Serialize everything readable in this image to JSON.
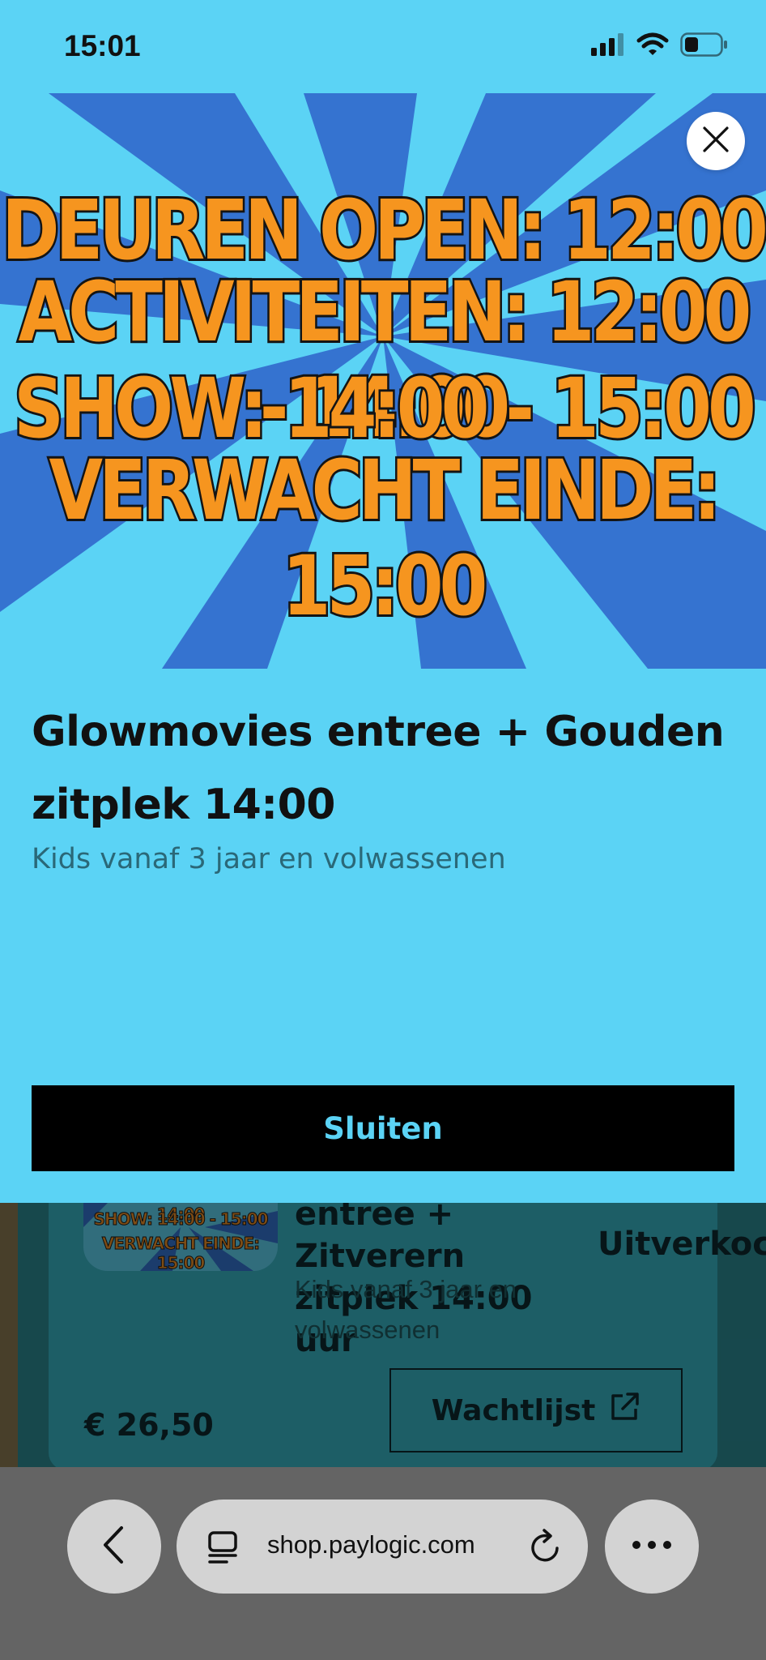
{
  "status_bar": {
    "time": "15:01",
    "icons": [
      "cellular-signal-icon",
      "wifi-icon",
      "battery-icon"
    ]
  },
  "hero": {
    "lines": [
      "DEUREN OPEN: 12:00",
      "ACTIVITEITEN: 12:00 - 14:00",
      "SHOW: 14:00 - 15:00",
      "VERWACHT EINDE: 15:00"
    ],
    "colors": {
      "background": "#5bd3f5",
      "rays": "#3573d0",
      "text": "#f6951f",
      "outline": "#141414"
    }
  },
  "modal": {
    "close_icon": "close-icon",
    "title": "Glowmovies entree + Gouden zitplek 14:00",
    "subtitle": "Kids vanaf 3 jaar en volwassenen",
    "primary_button": "Sluiten"
  },
  "background_listing": {
    "thumb_lines": [
      "ACTIVITEITEN: 12:00 - 14:00",
      "SHOW: 14:00 - 15:00",
      "VERWACHT EINDE: 15:00"
    ],
    "title": "entree + Zitverern zitplek 14:00 uur",
    "subtitle": "Kids vanaf 3 jaar en volwassenen",
    "status": "Uitverkoc",
    "price": "€ 26,50",
    "waitlist_button": "Wachtlijst",
    "waitlist_icon": "external-link-icon"
  },
  "browser": {
    "back_icon": "chevron-left-icon",
    "tabs_icon": "tab-overview-icon",
    "url": "shop.paylogic.com",
    "reload_icon": "reload-icon",
    "more_icon": "more-dots-icon"
  },
  "colors": {
    "modal_bg": "#5bd3f5",
    "button_bg": "#000000",
    "button_text": "#5bd3f5",
    "browser_bar": "#646464"
  }
}
